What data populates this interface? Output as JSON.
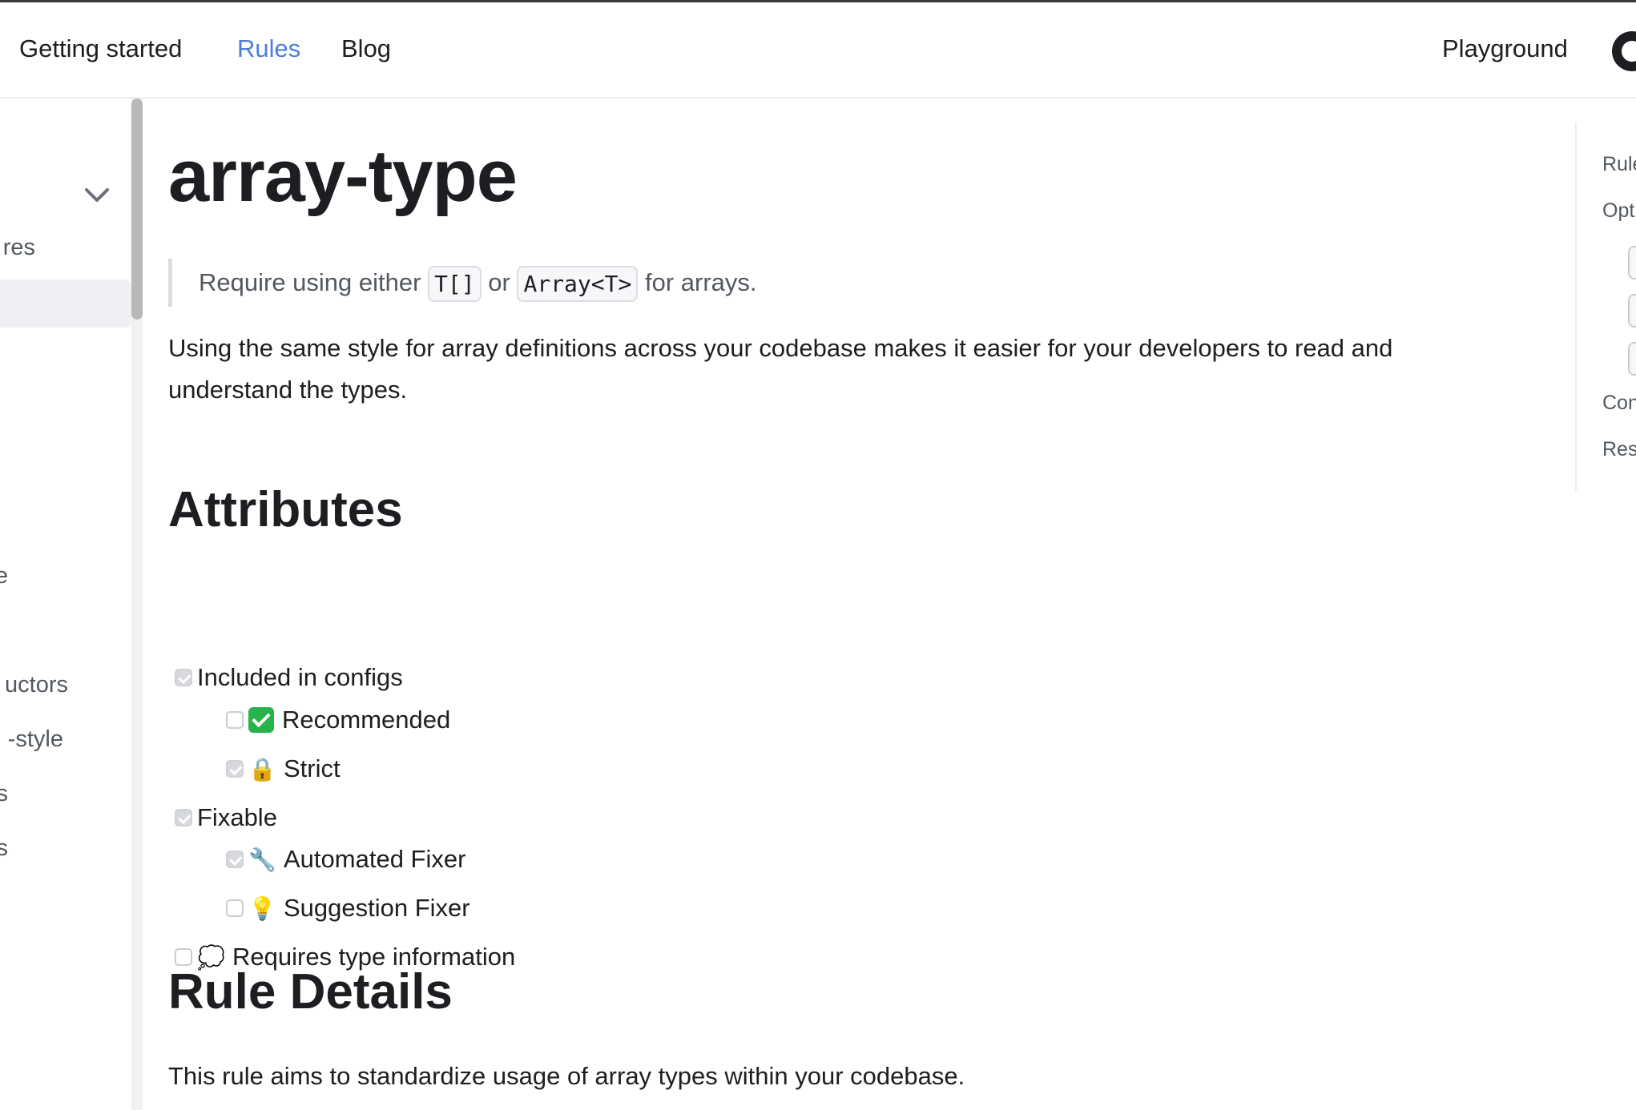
{
  "navbar": {
    "links": [
      {
        "label": "Getting started",
        "active": false
      },
      {
        "label": "Rules",
        "active": true
      },
      {
        "label": "Blog",
        "active": false
      }
    ],
    "playground": "Playground"
  },
  "sidebar": {
    "items": [
      "res",
      "e",
      "uctors",
      "-style",
      "s",
      "s"
    ]
  },
  "main": {
    "title": "array-type",
    "blockquote": {
      "prefix": "Require using either",
      "code1": "T[]",
      "middle": "or",
      "code2": "Array<T>",
      "suffix": "for arrays."
    },
    "intro": "Using the same style for array definitions across your codebase makes it easier for your developers to read and understand the types.",
    "attributes_heading": "Attributes",
    "attributes": [
      {
        "label": "Included in configs",
        "checked": true,
        "level": 0,
        "emoji": ""
      },
      {
        "label": "Recommended",
        "checked": false,
        "level": 1,
        "emoji": "✅"
      },
      {
        "label": "Strict",
        "checked": true,
        "level": 1,
        "emoji": "🔒"
      },
      {
        "label": "Fixable",
        "checked": true,
        "level": 0,
        "emoji": ""
      },
      {
        "label": "Automated Fixer",
        "checked": true,
        "level": 1,
        "emoji": "🔧"
      },
      {
        "label": "Suggestion Fixer",
        "checked": false,
        "level": 1,
        "emoji": "💡"
      },
      {
        "label": "Requires type information",
        "checked": false,
        "level": 0,
        "emoji": "💭"
      }
    ],
    "rule_details_heading": "Rule Details",
    "rule_details_text": "This rule aims to standardize usage of array types within your codebase."
  },
  "toc": {
    "items": [
      "Rule",
      "Opt",
      "Con",
      "Res"
    ]
  },
  "colors": {
    "accent": "#4a7fdc",
    "text": "#1c1e21",
    "muted": "#525860"
  }
}
